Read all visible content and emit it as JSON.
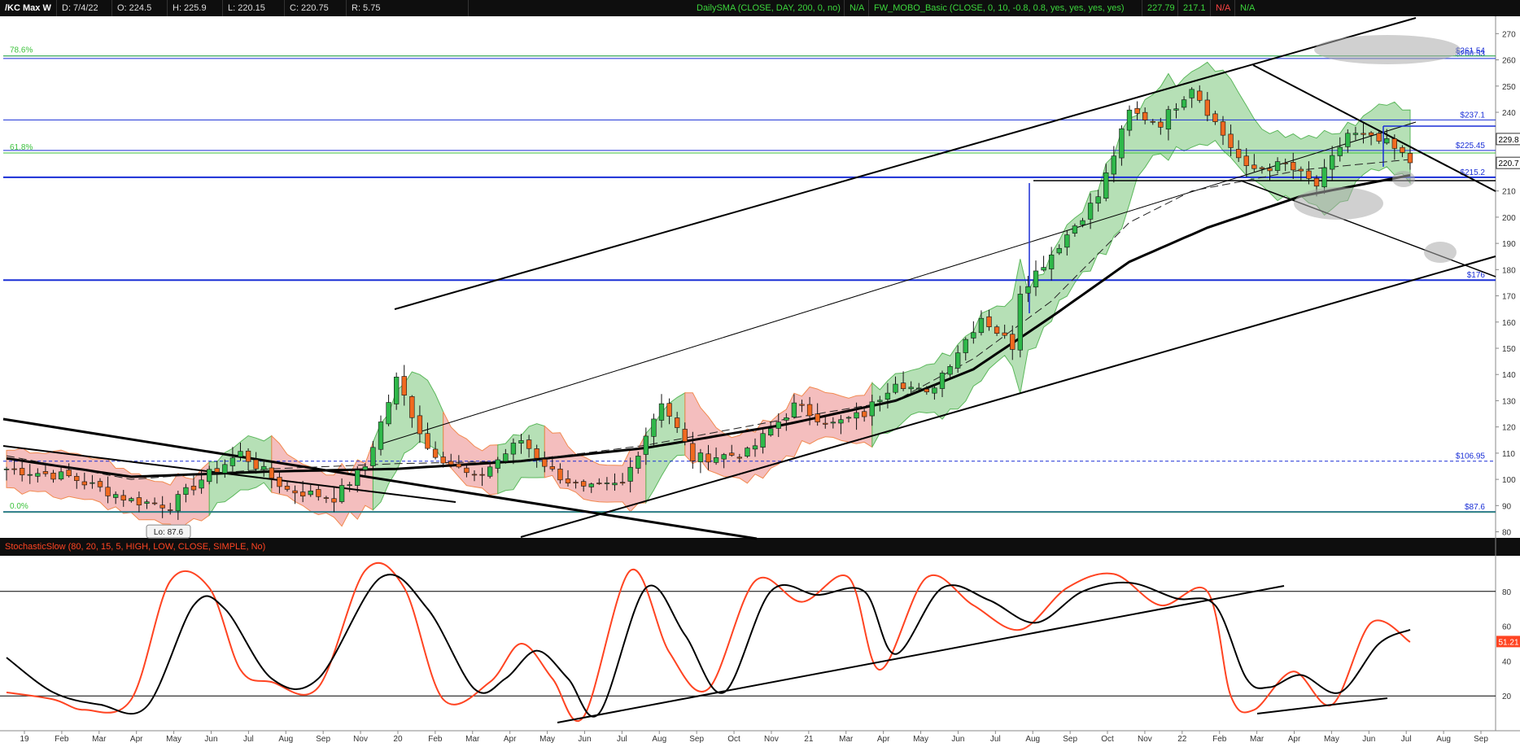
{
  "header": {
    "symbol": "/KC Max W",
    "date": "D: 7/4/22",
    "open": "O: 224.5",
    "high": "H: 225.9",
    "low": "L: 220.15",
    "close": "C: 220.75",
    "range": "R: 5.75",
    "study1": "DailySMA (CLOSE, DAY, 200, 0, no)",
    "study1_value": "N/A",
    "study2": "FW_MOBO_Basic (CLOSE, 0, 10, -0.8, 0.8, yes, yes, yes, yes)",
    "study2_v1": "227.79",
    "study2_v2": "217.1",
    "study2_v3": "N/A",
    "study2_v4": "N/A"
  },
  "colors": {
    "up_candle": "#2fb84a",
    "down_candle": "#f06a20",
    "band_up": "#9ed59e",
    "band_down": "#f0a8a8",
    "hline": "#1a2fd6",
    "fib": "#3cc23c",
    "stoch_k": "#ff4422",
    "stoch_d": "#000000"
  },
  "chart_data": [
    {
      "type": "candlestick",
      "ylim": [
        78,
        276
      ],
      "yticks": [
        80,
        90,
        100,
        110,
        120,
        130,
        140,
        150,
        160,
        170,
        180,
        190,
        200,
        210,
        220,
        230,
        240,
        250,
        260,
        270
      ],
      "x_labels": [
        "19",
        "Feb",
        "Mar",
        "Apr",
        "May",
        "Jun",
        "Jul",
        "Aug",
        "Sep",
        "Nov",
        "20",
        "Feb",
        "Mar",
        "Apr",
        "May",
        "Jun",
        "Jul",
        "Aug",
        "Sep",
        "Oct",
        "Nov",
        "21",
        "Mar",
        "Apr",
        "May",
        "Jun",
        "Jul",
        "Aug",
        "Sep",
        "Oct",
        "Nov",
        "22",
        "Feb",
        "Mar",
        "Apr",
        "May",
        "Jun",
        "Jul",
        "Aug",
        "Sep"
      ],
      "price_path": [
        [
          0,
          104
        ],
        [
          8,
          101
        ],
        [
          16,
          92
        ],
        [
          21,
          90
        ],
        [
          25,
          100
        ],
        [
          30,
          110
        ],
        [
          36,
          96
        ],
        [
          42,
          93
        ],
        [
          46,
          105
        ],
        [
          50,
          138
        ],
        [
          54,
          112
        ],
        [
          60,
          100
        ],
        [
          66,
          115
        ],
        [
          70,
          103
        ],
        [
          74,
          96
        ],
        [
          79,
          98
        ],
        [
          84,
          130
        ],
        [
          88,
          108
        ],
        [
          95,
          110
        ],
        [
          101,
          128
        ],
        [
          106,
          121
        ],
        [
          110,
          125
        ],
        [
          114,
          138
        ],
        [
          118,
          132
        ],
        [
          125,
          162
        ],
        [
          129,
          151
        ],
        [
          130,
          172
        ],
        [
          134,
          186
        ],
        [
          140,
          208
        ],
        [
          144,
          240
        ],
        [
          148,
          236
        ],
        [
          152,
          250
        ],
        [
          155,
          236
        ],
        [
          159,
          218
        ],
        [
          164,
          220
        ],
        [
          168,
          212
        ],
        [
          172,
          232
        ],
        [
          177,
          228
        ],
        [
          180,
          221
        ]
      ],
      "sma_slow_path": [
        [
          0,
          108
        ],
        [
          16,
          101
        ],
        [
          34,
          103
        ],
        [
          50,
          104
        ],
        [
          66,
          107
        ],
        [
          82,
          112
        ],
        [
          100,
          121
        ],
        [
          114,
          130
        ],
        [
          124,
          142
        ],
        [
          134,
          162
        ],
        [
          144,
          183
        ],
        [
          154,
          196
        ],
        [
          166,
          208
        ],
        [
          180,
          216
        ]
      ],
      "sma_fast_path": [
        [
          0,
          109
        ],
        [
          16,
          100
        ],
        [
          34,
          104
        ],
        [
          50,
          106
        ],
        [
          66,
          107
        ],
        [
          82,
          113
        ],
        [
          100,
          123
        ],
        [
          114,
          130
        ],
        [
          124,
          146
        ],
        [
          134,
          168
        ],
        [
          144,
          198
        ],
        [
          152,
          210
        ],
        [
          166,
          218
        ],
        [
          180,
          222
        ]
      ],
      "horizontal_levels": [
        {
          "value": 260.53,
          "label": "$260.53",
          "style": "solid"
        },
        {
          "value": 261.5,
          "label": "$261.54",
          "style": "solid"
        },
        {
          "value": 237.1,
          "label": "$237.1",
          "style": "solid"
        },
        {
          "value": 225.45,
          "label": "$225.45",
          "style": "solid"
        },
        {
          "value": 215.2,
          "label": "$215.2",
          "style": "solid"
        },
        {
          "value": 176,
          "label": "$176",
          "style": "solid"
        },
        {
          "value": 106.95,
          "label": "$106.95",
          "style": "dashed"
        },
        {
          "value": 87.6,
          "label": "$87.6",
          "style": "solid"
        }
      ],
      "fib_levels": [
        {
          "value": 261.5,
          "label": "78.6%"
        },
        {
          "value": 224.5,
          "label": "61.8%"
        },
        {
          "value": 87.6,
          "label": "0.0%"
        }
      ],
      "low_callout": "Lo: 87.6",
      "price_badges": [
        {
          "value": 229.8,
          "label": "229.8"
        },
        {
          "value": 220.7,
          "label": "220.7"
        }
      ]
    },
    {
      "type": "line",
      "title": "StochasticSlow (80, 20, 15, 5, HIGH, LOW, CLOSE, SIMPLE, No)",
      "last_value": "51.2175",
      "ylim": [
        0,
        100
      ],
      "yticks": [
        20,
        40,
        60,
        80
      ],
      "levels": [
        80,
        20
      ],
      "series": [
        {
          "name": "SlowK",
          "points": [
            [
              0,
              22
            ],
            [
              6,
              18
            ],
            [
              10,
              12
            ],
            [
              16,
              18
            ],
            [
              21,
              86
            ],
            [
              26,
              82
            ],
            [
              30,
              35
            ],
            [
              34,
              28
            ],
            [
              40,
              25
            ],
            [
              46,
              92
            ],
            [
              51,
              82
            ],
            [
              56,
              18
            ],
            [
              62,
              28
            ],
            [
              66,
              50
            ],
            [
              70,
              30
            ],
            [
              74,
              8
            ],
            [
              80,
              92
            ],
            [
              85,
              45
            ],
            [
              90,
              24
            ],
            [
              96,
              86
            ],
            [
              102,
              74
            ],
            [
              108,
              88
            ],
            [
              112,
              35
            ],
            [
              118,
              88
            ],
            [
              124,
              72
            ],
            [
              130,
              58
            ],
            [
              136,
              82
            ],
            [
              142,
              90
            ],
            [
              148,
              72
            ],
            [
              154,
              80
            ],
            [
              157,
              20
            ],
            [
              160,
              12
            ],
            [
              165,
              34
            ],
            [
              170,
              15
            ],
            [
              175,
              62
            ],
            [
              180,
              51
            ]
          ]
        },
        {
          "name": "SlowD",
          "points": [
            [
              0,
              42
            ],
            [
              6,
              22
            ],
            [
              12,
              15
            ],
            [
              18,
              14
            ],
            [
              24,
              72
            ],
            [
              28,
              70
            ],
            [
              34,
              30
            ],
            [
              40,
              30
            ],
            [
              48,
              88
            ],
            [
              54,
              70
            ],
            [
              60,
              24
            ],
            [
              64,
              30
            ],
            [
              68,
              46
            ],
            [
              72,
              30
            ],
            [
              76,
              10
            ],
            [
              82,
              82
            ],
            [
              87,
              55
            ],
            [
              92,
              22
            ],
            [
              98,
              80
            ],
            [
              104,
              78
            ],
            [
              110,
              80
            ],
            [
              114,
              44
            ],
            [
              120,
              82
            ],
            [
              126,
              75
            ],
            [
              132,
              62
            ],
            [
              138,
              80
            ],
            [
              144,
              85
            ],
            [
              150,
              76
            ],
            [
              155,
              72
            ],
            [
              159,
              30
            ],
            [
              162,
              25
            ],
            [
              166,
              32
            ],
            [
              171,
              22
            ],
            [
              176,
              50
            ],
            [
              180,
              58
            ]
          ]
        }
      ]
    }
  ]
}
